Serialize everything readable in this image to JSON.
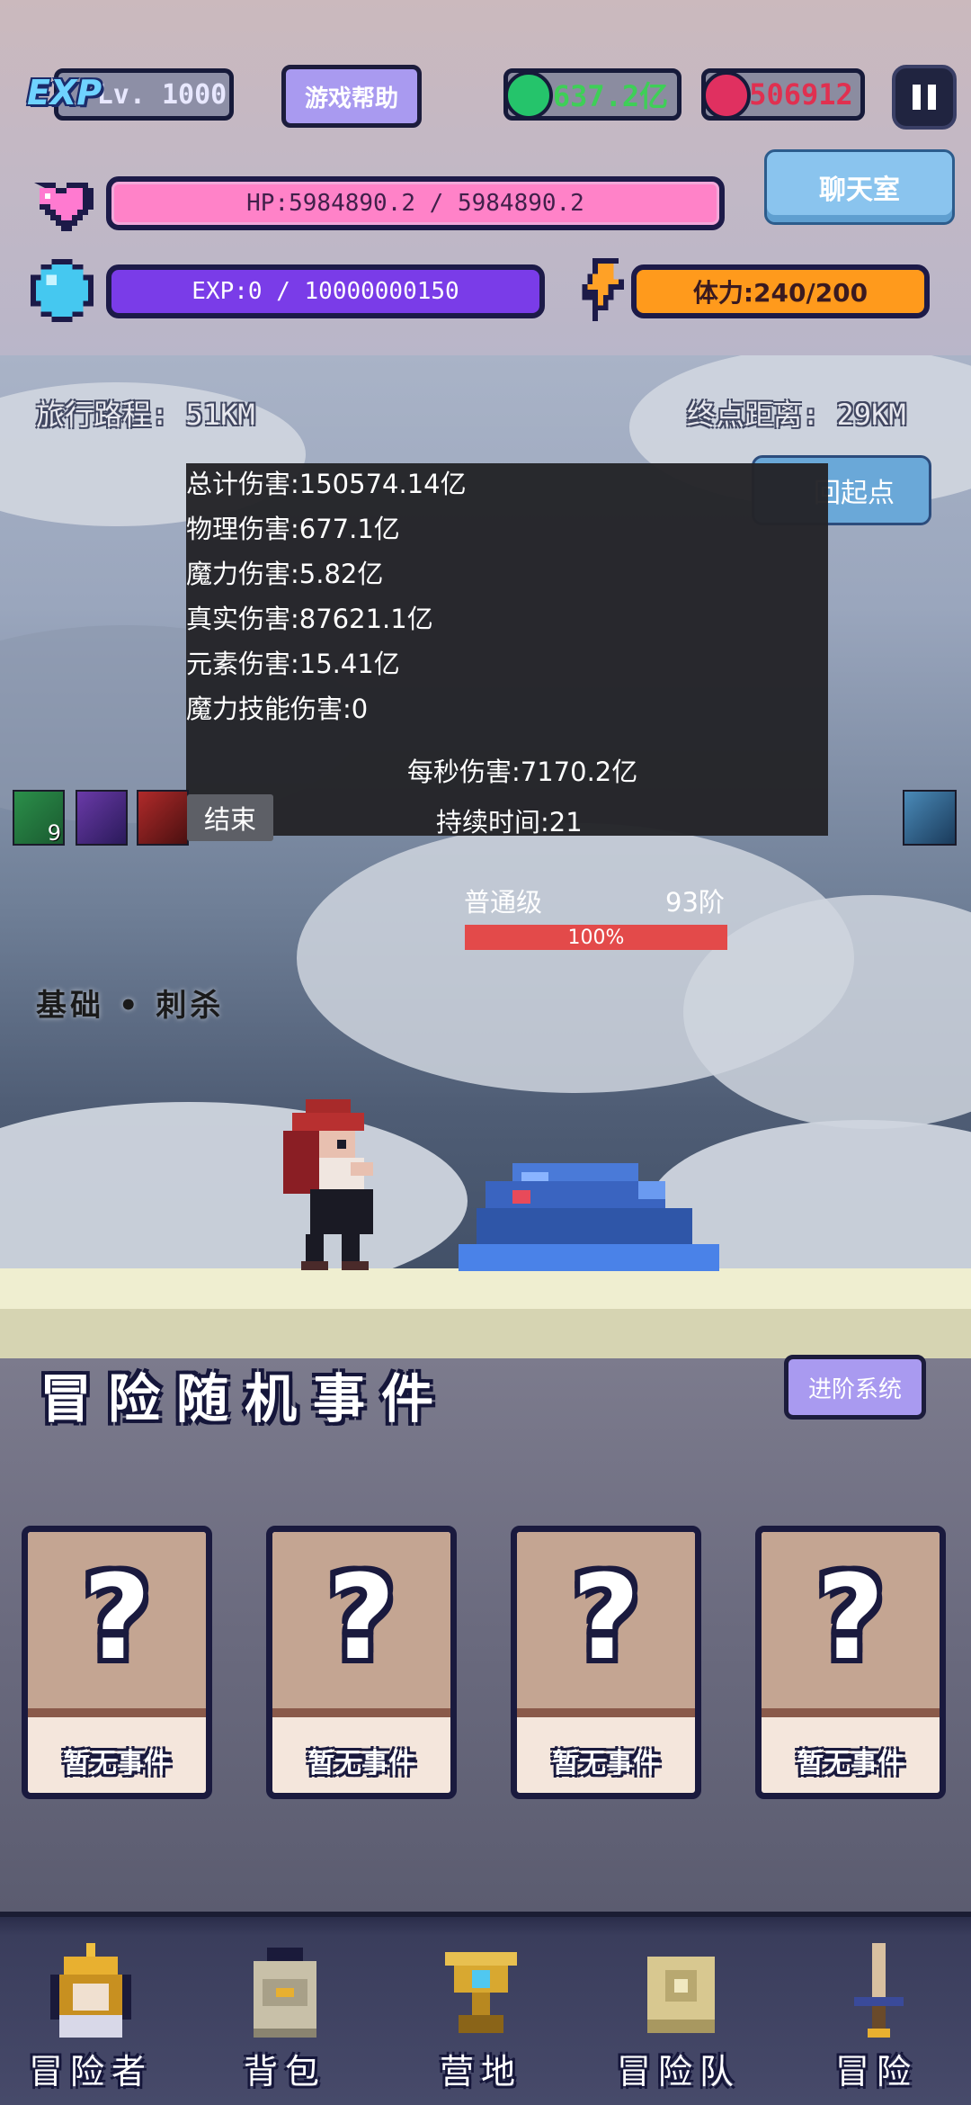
{
  "hud": {
    "exp_badge": "EXP",
    "level": "Lv. 1000",
    "help_label": "游戏帮助",
    "gems": "637.2亿",
    "rubies": "506912",
    "hp_text": "HP:5984890.2 / 5984890.2",
    "chat_label": "聊天室",
    "exp_text": "EXP:0 / 10000000150",
    "stamina_text": "体力:240/200",
    "hp_fraction": 1.0,
    "exp_fraction": 0.0
  },
  "scene": {
    "travel_distance": "旅行路程: 51KM",
    "end_distance": "终点距离: 29KM",
    "back_label": "回起点",
    "stats": {
      "lines": [
        "总计伤害:150574.14亿",
        "物理伤害:677.1亿",
        "魔力伤害:5.82亿",
        "真实伤害:87621.1亿",
        "元素伤害:15.41亿",
        "魔力技能伤害:0"
      ],
      "dps": "每秒伤害:7170.2亿",
      "duration": "持续时间:21",
      "end_label": "结束"
    },
    "skill_count": "9",
    "enemy": {
      "rank": "普通级",
      "tier": "93阶",
      "hp_text": "100%",
      "hp_fraction": 1.0
    },
    "skill_cast": "基础 • 刺杀"
  },
  "events": {
    "title": "冒险随机事件",
    "advance_label": "进阶系统",
    "cards": [
      {
        "symbol": "?",
        "label": "暂无事件"
      },
      {
        "symbol": "?",
        "label": "暂无事件"
      },
      {
        "symbol": "?",
        "label": "暂无事件"
      },
      {
        "symbol": "?",
        "label": "暂无事件"
      }
    ]
  },
  "nav": {
    "items": [
      {
        "label": "冒险者",
        "icon": "helmet-icon"
      },
      {
        "label": "背包",
        "icon": "backpack-icon"
      },
      {
        "label": "营地",
        "icon": "trophy-icon"
      },
      {
        "label": "冒险队",
        "icon": "book-icon"
      },
      {
        "label": "冒险",
        "icon": "sword-icon"
      }
    ]
  },
  "colors": {
    "hp": "#ff82c8",
    "exp": "#7a3ce8",
    "stamina": "#ff9a1c",
    "button_purple": "#a99af0",
    "button_blue": "#8ac4ee",
    "enemy_hp": "#e34a4a"
  }
}
